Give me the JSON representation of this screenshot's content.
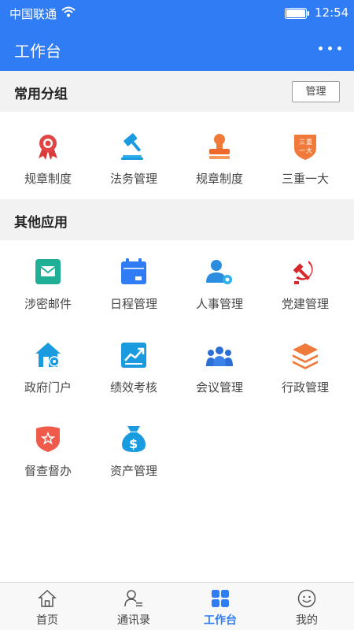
{
  "status_bar": {
    "carrier": "中国联通",
    "time": "12:54"
  },
  "app_bar": {
    "title": "工作台"
  },
  "common_group": {
    "title": "常用分组",
    "manage_label": "管理",
    "items": [
      {
        "label": "规章制度",
        "icon": "ribbon-award-icon"
      },
      {
        "label": "法务管理",
        "icon": "gavel-icon"
      },
      {
        "label": "规章制度",
        "icon": "stamp-icon"
      },
      {
        "label": "三重一大",
        "icon": "shield-badge-icon"
      }
    ]
  },
  "other_apps": {
    "title": "其他应用",
    "items": [
      {
        "label": "涉密邮件",
        "icon": "mail-icon"
      },
      {
        "label": "日程管理",
        "icon": "calendar-icon"
      },
      {
        "label": "人事管理",
        "icon": "user-gear-icon"
      },
      {
        "label": "党建管理",
        "icon": "hammer-sickle-icon"
      },
      {
        "label": "政府门户",
        "icon": "house-gear-icon"
      },
      {
        "label": "绩效考核",
        "icon": "trend-chart-icon"
      },
      {
        "label": "会议管理",
        "icon": "group-icon"
      },
      {
        "label": "行政管理",
        "icon": "layers-icon"
      },
      {
        "label": "督查督办",
        "icon": "star-shield-icon"
      },
      {
        "label": "资产管理",
        "icon": "money-bag-icon"
      }
    ]
  },
  "tabs": [
    {
      "label": "首页",
      "icon": "home-icon",
      "active": false
    },
    {
      "label": "通讯录",
      "icon": "contacts-icon",
      "active": false
    },
    {
      "label": "工作台",
      "icon": "grid-icon",
      "active": true
    },
    {
      "label": "我的",
      "icon": "smiley-icon",
      "active": false
    }
  ]
}
